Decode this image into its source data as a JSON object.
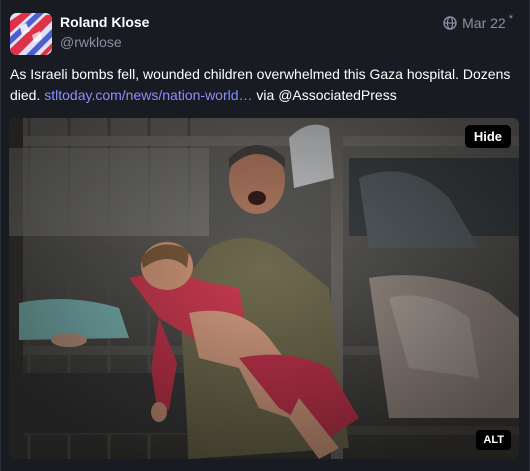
{
  "post": {
    "author": {
      "display_name": "Roland Klose",
      "handle": "@rwklose"
    },
    "visibility_icon": "globe-icon",
    "date": "Mar 22",
    "edited_marker": "*",
    "text_before_link": "As Israeli bombs fell, wounded children overwhelmed this Gaza hospital. Dozens died.",
    "link_text": "stltoday.com/news/nation-world…",
    "text_after_link": "via @AssociatedPress",
    "media": {
      "hide_label": "Hide",
      "alt_label": "ALT"
    }
  },
  "colors": {
    "background": "#191b22",
    "muted_text": "#8c8fa6",
    "link": "#8c8dff"
  }
}
